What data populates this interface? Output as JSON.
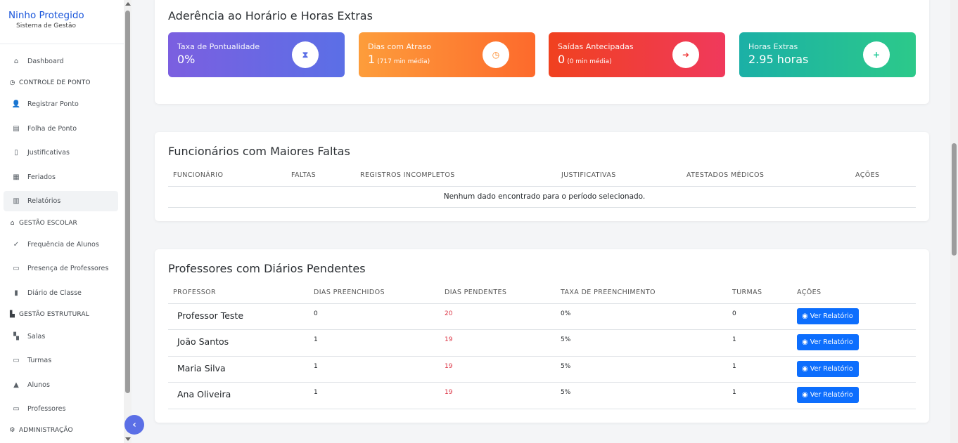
{
  "brand": {
    "title": "Ninho Protegido",
    "subtitle": "Sistema de Gestão"
  },
  "sidebar": {
    "items": [
      {
        "label": "Dashboard",
        "icon": "home-icon"
      },
      {
        "label": "CONTROLE DE PONTO",
        "icon": "clock-icon",
        "section": true
      },
      {
        "label": "Registrar Ponto",
        "icon": "user-clock-icon"
      },
      {
        "label": "Folha de Ponto",
        "icon": "clipboard-icon"
      },
      {
        "label": "Justificativas",
        "icon": "file-icon"
      },
      {
        "label": "Feriados",
        "icon": "calendar-icon"
      },
      {
        "label": "Relatórios",
        "icon": "chart-icon",
        "active": true
      },
      {
        "label": "GESTÃO ESCOLAR",
        "icon": "school-icon",
        "section": true
      },
      {
        "label": "Frequência de Alunos",
        "icon": "user-check-icon"
      },
      {
        "label": "Presença de Professores",
        "icon": "chalkboard-teacher-icon"
      },
      {
        "label": "Diário de Classe",
        "icon": "book-icon"
      },
      {
        "label": "GESTÃO ESTRUTURAL",
        "icon": "building-icon",
        "section": true
      },
      {
        "label": "Salas",
        "icon": "door-icon"
      },
      {
        "label": "Turmas",
        "icon": "laptop-icon"
      },
      {
        "label": "Alunos",
        "icon": "graduate-icon"
      },
      {
        "label": "Professores",
        "icon": "chalkboard-teacher-icon"
      },
      {
        "label": "ADMINISTRAÇÃO",
        "icon": "gear-icon",
        "section": true
      }
    ]
  },
  "adherence": {
    "title": "Aderência ao Horário e Horas Extras",
    "cards": [
      {
        "label": "Taxa de Pontualidade",
        "value": "0%",
        "note": "",
        "icon": "hourglass-icon",
        "color": "#5b6fe6"
      },
      {
        "label": "Dias com Atraso",
        "value": "1",
        "note": "(717 min média)",
        "icon": "clock-icon",
        "color": "#fd7e14"
      },
      {
        "label": "Saídas Antecipadas",
        "value": "0",
        "note": "(0 min média)",
        "icon": "sign-out-icon",
        "color": "#f03e3e"
      },
      {
        "label": "Horas Extras",
        "value": "2.95 horas",
        "note": "",
        "icon": "plus-circle-icon",
        "color": "#20c997"
      }
    ]
  },
  "absences": {
    "title": "Funcionários com Maiores Faltas",
    "headers": [
      "FUNCIONÁRIO",
      "FALTAS",
      "REGISTROS INCOMPLETOS",
      "JUSTIFICATIVAS",
      "ATESTADOS MÉDICOS",
      "AÇÕES"
    ],
    "empty_message": "Nenhum dado encontrado para o período selecionado."
  },
  "diaries": {
    "title": "Professores com Diários Pendentes",
    "headers": [
      "PROFESSOR",
      "DIAS PREENCHIDOS",
      "DIAS PENDENTES",
      "TAXA DE PREENCHIMENTO",
      "TURMAS",
      "AÇÕES"
    ],
    "button_label": "Ver Relatório",
    "rows": [
      {
        "name": "Professor Teste",
        "filled": "0",
        "pending": "20",
        "rate": "0%",
        "classes": "0"
      },
      {
        "name": "João Santos",
        "filled": "1",
        "pending": "19",
        "rate": "5%",
        "classes": "1"
      },
      {
        "name": "Maria Silva",
        "filled": "1",
        "pending": "19",
        "rate": "5%",
        "classes": "1"
      },
      {
        "name": "Ana Oliveira",
        "filled": "1",
        "pending": "19",
        "rate": "5%",
        "classes": "1"
      }
    ]
  }
}
